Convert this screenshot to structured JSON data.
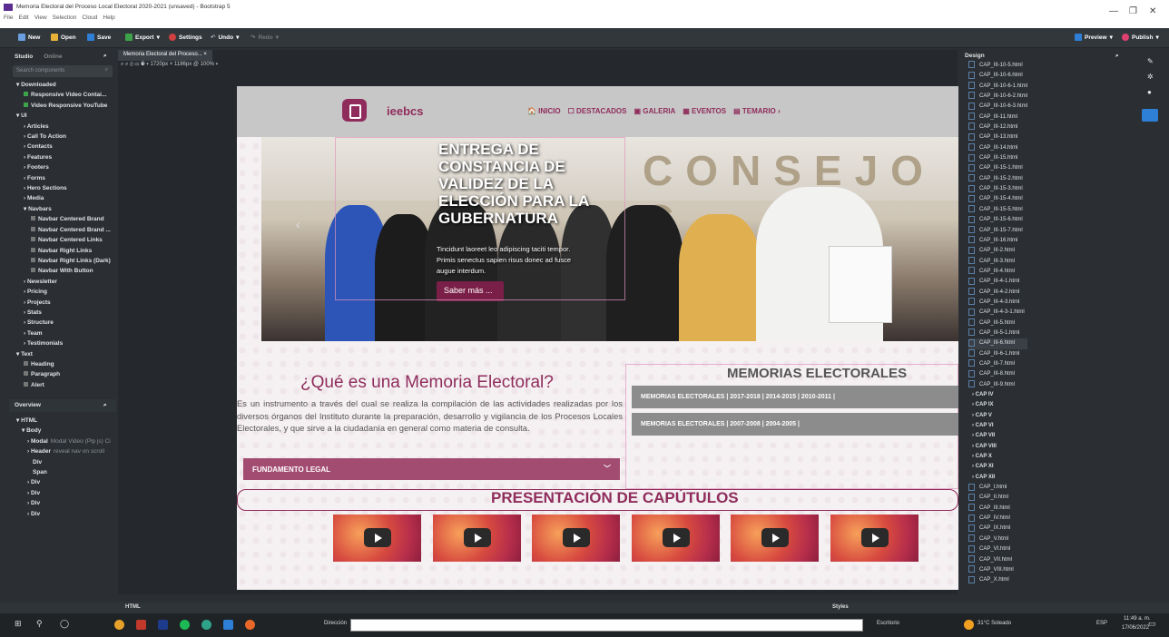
{
  "window": {
    "title": "Memoria Electoral del Proceso Local Electoral 2020-2021 (unsaved) - Bootstrap 5",
    "menu": [
      "File",
      "Edit",
      "View",
      "Selection",
      "Cloud",
      "Help"
    ]
  },
  "toolbar": {
    "new": "New",
    "open": "Open",
    "save": "Save",
    "export": "Export",
    "settings": "Settings",
    "undo": "Undo",
    "redo": "Redo",
    "preview": "Preview",
    "publish": "Publish"
  },
  "left": {
    "tabs": [
      "Studio",
      "Online"
    ],
    "search_placeholder": "Search components",
    "items": [
      {
        "t": "▾ Downloaded",
        "c": "cat"
      },
      {
        "t": "Responsive Video Contai...",
        "c": "sub",
        "col": "#3da34a"
      },
      {
        "t": "Video Responsive YouTube",
        "c": "sub",
        "col": "#3da34a"
      },
      {
        "t": "▾ UI",
        "c": "cat"
      },
      {
        "t": "› Articles",
        "c": "sub"
      },
      {
        "t": "› Call To Action",
        "c": "sub"
      },
      {
        "t": "› Contacts",
        "c": "sub"
      },
      {
        "t": "› Features",
        "c": "sub"
      },
      {
        "t": "› Footers",
        "c": "sub"
      },
      {
        "t": "› Forms",
        "c": "sub"
      },
      {
        "t": "› Hero Sections",
        "c": "sub"
      },
      {
        "t": "› Media",
        "c": "sub"
      },
      {
        "t": "▾ Navbars",
        "c": "sub"
      },
      {
        "t": "Navbar Centered Brand",
        "c": "sub2",
        "col": "#777"
      },
      {
        "t": "Navbar Centered Brand ...",
        "c": "sub2",
        "col": "#777"
      },
      {
        "t": "Navbar Centered Links",
        "c": "sub2",
        "col": "#777"
      },
      {
        "t": "Navbar Right Links",
        "c": "sub2",
        "col": "#777"
      },
      {
        "t": "Navbar Right Links (Dark)",
        "c": "sub2",
        "col": "#777"
      },
      {
        "t": "Navbar With Button",
        "c": "sub2",
        "col": "#777"
      },
      {
        "t": "› Newsletter",
        "c": "sub"
      },
      {
        "t": "› Pricing",
        "c": "sub"
      },
      {
        "t": "› Projects",
        "c": "sub"
      },
      {
        "t": "› Stats",
        "c": "sub"
      },
      {
        "t": "› Structure",
        "c": "sub"
      },
      {
        "t": "› Team",
        "c": "sub"
      },
      {
        "t": "› Testimonials",
        "c": "sub"
      },
      {
        "t": "▾ Text",
        "c": "cat"
      },
      {
        "t": "Heading",
        "c": "sub",
        "col": "#777"
      },
      {
        "t": "Paragraph",
        "c": "sub",
        "col": "#777"
      },
      {
        "t": "Alert",
        "c": "sub",
        "col": "#777"
      }
    ]
  },
  "overview": {
    "title": "Overview",
    "items": [
      {
        "t": "▾ HTML",
        "p": 0
      },
      {
        "t": "▾ Body",
        "p": 1
      },
      {
        "t": "› Modal",
        "x": "Modal Video (Plp js) Ci",
        "p": 2
      },
      {
        "t": "› Header",
        "x": "reveal nav on scroll",
        "p": 2
      },
      {
        "t": "Div",
        "p": 3
      },
      {
        "t": "Span",
        "p": 3
      },
      {
        "t": "› Div",
        "p": 2
      },
      {
        "t": "› Div",
        "p": 2
      },
      {
        "t": "› Div",
        "p": 2
      },
      {
        "t": "› Div",
        "p": 2
      }
    ]
  },
  "editor": {
    "tab": "Memoria Electoral del Proceso...",
    "zoom": "1720px × 1186px @ 100%"
  },
  "site": {
    "brand": "ieebcs",
    "nav": [
      "🏠 INICIO",
      "☐ DESTACADOS",
      "▣ GALERIA",
      "▦ EVENTOS",
      "▤ TEMARIO ›"
    ],
    "hero_title": "ENTREGA DE CONSTANCIA DE VALIDEZ DE LA ELECCIÓN PARA LA GUBERNATURA",
    "hero_wall": "CONSEJO G",
    "hero_text": "Tincidunt laoreet leo adipiscing taciti tempor. Primis senectus sapien risus donec ad fusce augue interdum.",
    "hero_button": "Saber más ...",
    "q_title": "¿Qué es una Memoria Electoral?",
    "q_body": "Es un instrumento a través del cual se realiza la compilación de las actividades realizadas por los diversos órganos del Instituto durante la preparación, desarrollo y vigilancia de los Procesos Locales Electorales, y que sirve a la ciudadanía en general como materia de consulta.",
    "fundamento": "FUNDAMENTO LEGAL",
    "mem_title": "MEMORIAS ELECTORALES",
    "mem1": "MEMORIAS ELECTORALES | 2017-2018 | 2014-2015 | 2010-2011 |",
    "mem2": "MEMORIAS ELECTORALES | 2007-2008 | 2004-2005 |",
    "pres_title": "PRESENTACIÓN DE CAPÚTULOS",
    "thumbs": 6
  },
  "design": {
    "title": "Design",
    "files": [
      {
        "t": "CAP_III-10-5.html",
        "f": 1
      },
      {
        "t": "CAP_III-10-6.html",
        "f": 1
      },
      {
        "t": "CAP_III-10-6-1.html",
        "f": 1
      },
      {
        "t": "CAP_III-10-6-2.html",
        "f": 1
      },
      {
        "t": "CAP_III-10-6-3.html",
        "f": 1
      },
      {
        "t": "CAP_III-11.html",
        "f": 1
      },
      {
        "t": "CAP_III-12.html",
        "f": 1
      },
      {
        "t": "CAP_III-13.html",
        "f": 1
      },
      {
        "t": "CAP_III-14.html",
        "f": 1
      },
      {
        "t": "CAP_III-15.html",
        "f": 1
      },
      {
        "t": "CAP_III-15-1.html",
        "f": 1
      },
      {
        "t": "CAP_III-15-2.html",
        "f": 1
      },
      {
        "t": "CAP_III-15-3.html",
        "f": 1
      },
      {
        "t": "CAP_III-15-4.html",
        "f": 1
      },
      {
        "t": "CAP_III-15-5.html",
        "f": 1
      },
      {
        "t": "CAP_III-15-6.html",
        "f": 1
      },
      {
        "t": "CAP_III-15-7.html",
        "f": 1
      },
      {
        "t": "CAP_III-16.html",
        "f": 1
      },
      {
        "t": "CAP_III-2.html",
        "f": 1
      },
      {
        "t": "CAP_III-3.html",
        "f": 1
      },
      {
        "t": "CAP_III-4.html",
        "f": 1
      },
      {
        "t": "CAP_III-4-1.html",
        "f": 1
      },
      {
        "t": "CAP_III-4-2.html",
        "f": 1
      },
      {
        "t": "CAP_III-4-3.html",
        "f": 1
      },
      {
        "t": "CAP_III-4-3-1.html",
        "f": 1
      },
      {
        "t": "CAP_III-5.html",
        "f": 1
      },
      {
        "t": "CAP_III-5-1.html",
        "f": 1
      },
      {
        "t": "CAP_III-6.html",
        "f": 1,
        "h": 1
      },
      {
        "t": "CAP_III-6-1.html",
        "f": 1
      },
      {
        "t": "CAP_III-7.html",
        "f": 1
      },
      {
        "t": "CAP_III-8.html",
        "f": 1
      },
      {
        "t": "CAP_III-9.html",
        "f": 1
      },
      {
        "t": "› CAP IV"
      },
      {
        "t": "› CAP IX"
      },
      {
        "t": "› CAP V"
      },
      {
        "t": "› CAP VI"
      },
      {
        "t": "› CAP VII"
      },
      {
        "t": "› CAP VIII"
      },
      {
        "t": "› CAP X"
      },
      {
        "t": "› CAP XI"
      },
      {
        "t": "› CAP XII"
      },
      {
        "t": "CAP_I.html",
        "f": 1
      },
      {
        "t": "CAP_II.html",
        "f": 1
      },
      {
        "t": "CAP_III.html",
        "f": 1
      },
      {
        "t": "CAP_IV.html",
        "f": 1
      },
      {
        "t": "CAP_IX.html",
        "f": 1
      },
      {
        "t": "CAP_V.html",
        "f": 1
      },
      {
        "t": "CAP_VI.html",
        "f": 1
      },
      {
        "t": "CAP_VII.html",
        "f": 1
      },
      {
        "t": "CAP_VIII.html",
        "f": 1
      },
      {
        "t": "CAP_X.html",
        "f": 1
      }
    ]
  },
  "bottom": {
    "html": "HTML",
    "styles": "Styles"
  },
  "taskbar": {
    "address_label": "Dirección",
    "desktop": "Escritorio",
    "weather": "31°C Soleado",
    "lang": "ESP",
    "time": "11:49 a. m.",
    "date": "17/06/2022"
  }
}
